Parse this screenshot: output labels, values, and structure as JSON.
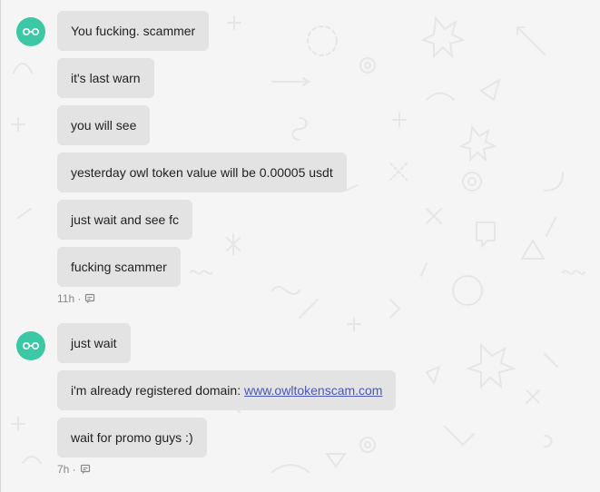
{
  "groups": [
    {
      "avatar_icon": "owl-eyes-icon",
      "messages": [
        {
          "text": "You fucking. scammer"
        },
        {
          "text": "it's last warn"
        },
        {
          "text": "you will see"
        },
        {
          "text": "yesterday owl token value will be 0.00005 usdt"
        },
        {
          "text": "just wait and see fc"
        },
        {
          "text": "fucking scammer"
        }
      ],
      "timestamp": "11h ·"
    },
    {
      "avatar_icon": "owl-eyes-icon",
      "messages": [
        {
          "text": "just wait"
        },
        {
          "text": "i'm already registered domain: ",
          "link": "www.owltokenscam.com"
        },
        {
          "text": "wait for promo guys :)"
        }
      ],
      "timestamp": "7h ·"
    }
  ],
  "colors": {
    "avatar": "#3cc8a4",
    "bubble": "#e3e3e3",
    "link": "#4a56b8",
    "background": "#f5f5f5"
  }
}
